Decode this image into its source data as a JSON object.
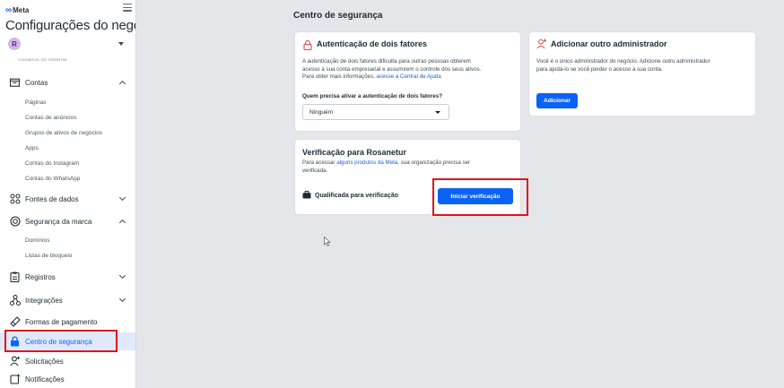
{
  "header": {
    "brand": "Meta",
    "title": "Configurações do negócio",
    "account_initial": "R",
    "cutoff_text": "Usuários do sistema"
  },
  "sidebar": {
    "groups": [
      {
        "label": "Contas",
        "icon": "folder-icon",
        "state": "expanded"
      },
      {
        "label": "Fontes de dados",
        "icon": "data-sources-icon",
        "state": "collapsed"
      },
      {
        "label": "Segurança da marca",
        "icon": "shield-icon",
        "state": "expanded"
      },
      {
        "label": "Registros",
        "icon": "clipboard-icon",
        "state": "collapsed"
      },
      {
        "label": "Integrações",
        "icon": "integrations-icon",
        "state": "collapsed"
      }
    ],
    "contas_items": [
      "Páginas",
      "Contas de anúncios",
      "Grupos de ativos de negócios",
      "Apps",
      "Contas do Instagram",
      "Contas do WhatsApp"
    ],
    "seguranca_items": [
      "Domínios",
      "Listas de bloqueio"
    ],
    "bottom_items": [
      {
        "label": "Formas de pagamento",
        "icon": "payment-icon"
      },
      {
        "label": "Centro de segurança",
        "icon": "lock-icon",
        "active": true
      },
      {
        "label": "Solicitações",
        "icon": "person-request-icon"
      },
      {
        "label": "Notificações",
        "icon": "notification-icon"
      }
    ]
  },
  "main": {
    "title": "Centro de segurança",
    "two_factor": {
      "title": "Autenticação de dois fatores",
      "text_1": "A autenticação de dois fatores dificulta para outras pessoas obterem",
      "text_2": "acesso à sua conta empresarial e assumirem o controle dos seus ativos.",
      "text_3": "Para obter mais informações, ",
      "link": "acesse a Central de Ajuda",
      "question": "Quem precisa ativar a autenticação de dois fatores?",
      "dropdown_value": "Ninguém"
    },
    "admin": {
      "title": "Adicionar outro administrador",
      "text_1": "Você é o único administrador do negócio. Adicione outro administrador",
      "text_2": "para ajudá-lo se você perder o acesso à sua conta.",
      "button": "Adicionar"
    },
    "verification": {
      "title": "Verificação para Rosanetur",
      "text_1a": "Para acessar ",
      "link": "alguns produtos da Meta",
      "text_1b": ", sua organização precisa ser",
      "text_2": "verificada.",
      "eligibility": "Qualificada para verificação",
      "button": "Iniciar verificação"
    }
  },
  "colors": {
    "accent": "#0866ff",
    "highlight_box": "#e0141a",
    "background": "#e4e6e9"
  }
}
